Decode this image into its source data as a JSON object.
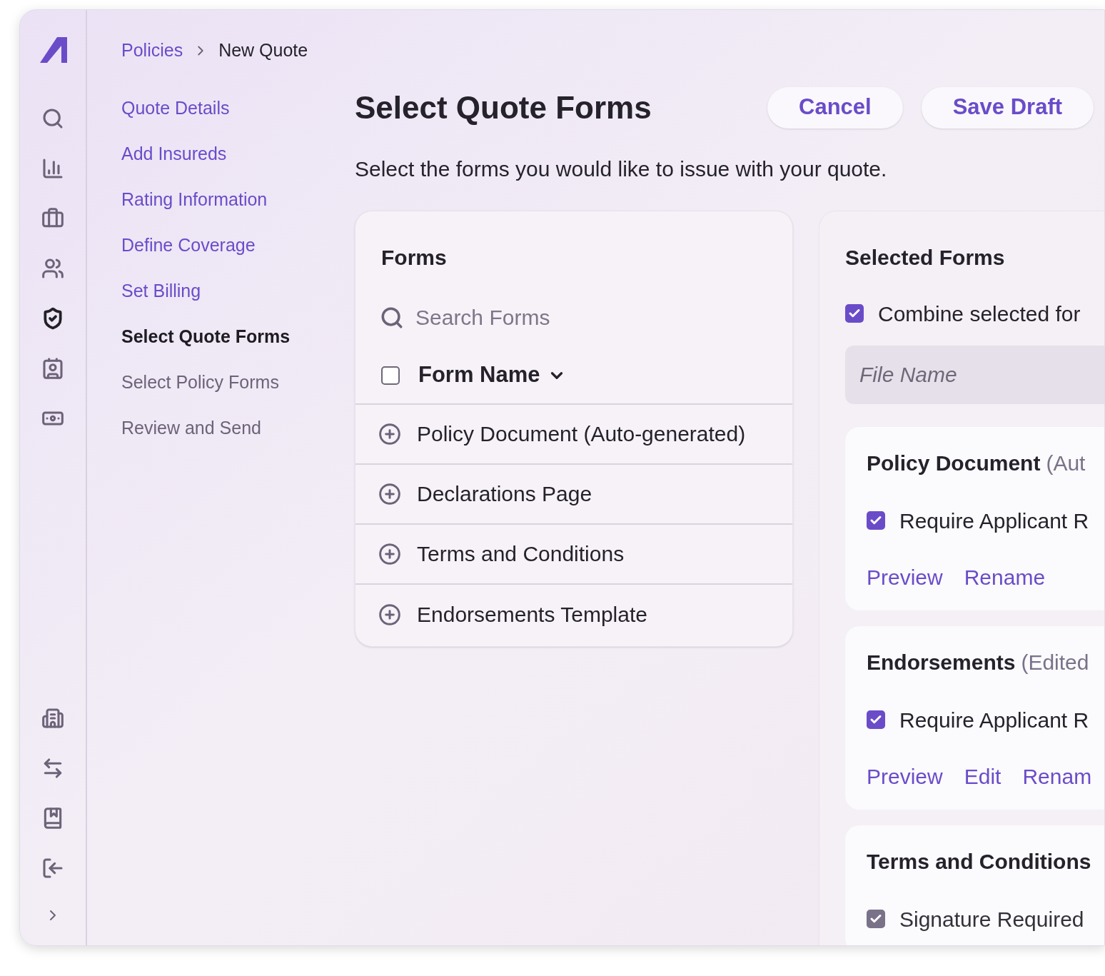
{
  "sidebar": {
    "nav_items": [
      {
        "selected": false
      },
      {
        "selected": false
      },
      {
        "selected": false
      },
      {
        "selected": false
      },
      {
        "selected": true
      },
      {
        "selected": false
      },
      {
        "selected": false
      }
    ]
  },
  "breadcrumb": {
    "items": [
      "Policies",
      "New Quote"
    ]
  },
  "steps": [
    {
      "label": "Quote Details",
      "completed": true,
      "selected": false
    },
    {
      "label": "Add Insureds",
      "completed": true,
      "selected": false
    },
    {
      "label": "Rating Information",
      "completed": true,
      "selected": false
    },
    {
      "label": "Define Coverage",
      "completed": true,
      "selected": false
    },
    {
      "label": "Set Billing",
      "completed": true,
      "selected": false
    },
    {
      "label": "Select Quote Forms",
      "completed": false,
      "selected": true
    },
    {
      "label": "Select Policy Forms",
      "completed": false,
      "selected": false
    },
    {
      "label": "Review and Send",
      "completed": false,
      "selected": false
    }
  ],
  "page": {
    "title": "Select Quote Forms",
    "subtitle": "Select the forms you would like to issue with your quote.",
    "buttons": [
      "Cancel",
      "Save Draft"
    ]
  },
  "forms_panel": {
    "title": "Forms",
    "search": {
      "placeholder": "Search Forms"
    },
    "header": {
      "label": "Form Name",
      "checked": false
    },
    "rows": [
      "Policy Document (Auto-generated)",
      "Declarations Page",
      "Terms and Conditions",
      "Endorsements Template"
    ]
  },
  "selected_panel": {
    "title": "Selected Forms",
    "combine": {
      "label": "Combine selected for",
      "checked": true
    },
    "file_name": {
      "placeholder": "File Name"
    },
    "cards": [
      {
        "title": "Policy Document",
        "note": "(Aut",
        "option": {
          "label": "Require Applicant R",
          "checked": true,
          "disabled": false
        },
        "actions": [
          "Preview",
          "Rename"
        ]
      },
      {
        "title": "Endorsements",
        "note": "(Edited",
        "option": {
          "label": "Require Applicant R",
          "checked": true,
          "disabled": false
        },
        "actions": [
          "Preview",
          "Edit",
          "Renam"
        ]
      },
      {
        "title": "Terms and Conditions",
        "option": {
          "label": "Signature Required",
          "checked": true,
          "disabled": true
        }
      }
    ]
  }
}
